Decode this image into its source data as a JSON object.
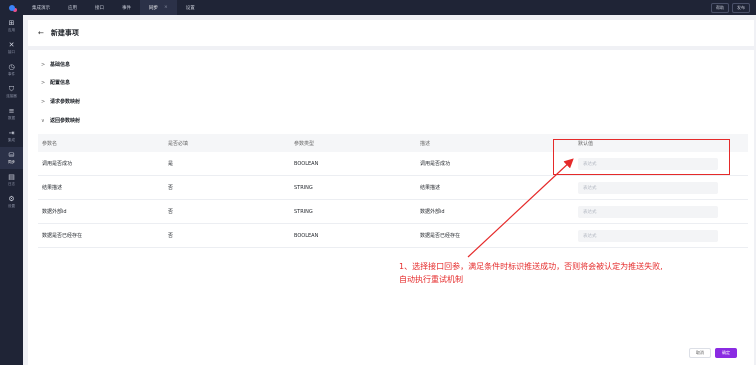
{
  "topbar": {
    "nav": [
      {
        "label": "集成演示",
        "active": false
      },
      {
        "label": "应用",
        "active": false
      },
      {
        "label": "接口",
        "active": false
      },
      {
        "label": "事件",
        "active": false
      },
      {
        "label": "同步",
        "active": true,
        "close": "×"
      },
      {
        "label": "设置",
        "active": false
      }
    ],
    "right_buttons": [
      "帮助",
      "发布"
    ]
  },
  "sidebar": {
    "items": [
      {
        "icon": "⊞",
        "label": "应用",
        "active": false
      },
      {
        "icon": "✕",
        "label": "接口",
        "active": false
      },
      {
        "icon": "◷",
        "label": "事件",
        "active": false
      },
      {
        "icon": "⛉",
        "label": "连接器",
        "active": false
      },
      {
        "icon": "≡",
        "label": "数据",
        "active": false
      },
      {
        "icon": "⇥",
        "label": "集成",
        "active": false
      },
      {
        "icon": "⛁",
        "label": "同步",
        "active": true
      },
      {
        "icon": "▤",
        "label": "日志",
        "active": false
      },
      {
        "icon": "⚙",
        "label": "设置",
        "active": false
      }
    ]
  },
  "header": {
    "back": "←",
    "title": "新建事项"
  },
  "sections": [
    {
      "chevron": ">",
      "label": "基础信息"
    },
    {
      "chevron": ">",
      "label": "配置信息"
    },
    {
      "chevron": ">",
      "label": "请求参数映射"
    },
    {
      "chevron": "∨",
      "label": "返回参数映射"
    }
  ],
  "table": {
    "headers": [
      "参数名",
      "是否必填",
      "参数类型",
      "描述",
      "默认值"
    ],
    "rows": [
      {
        "name": "调用是否成功",
        "required": "是",
        "type": "BOOLEAN",
        "desc": "调用是否成功",
        "placeholder": "表达式"
      },
      {
        "name": "结果描述",
        "required": "否",
        "type": "STRING",
        "desc": "结果描述",
        "placeholder": "表达式"
      },
      {
        "name": "数据外部id",
        "required": "否",
        "type": "STRING",
        "desc": "数据外部id",
        "placeholder": "表达式"
      },
      {
        "name": "数据是否已经存在",
        "required": "否",
        "type": "BOOLEAN",
        "desc": "数据是否已经存在",
        "placeholder": "表达式"
      }
    ]
  },
  "annotation": {
    "line1": "1、选择接口回参，满足条件时标识推送成功，否则将会被认定为推送失败,",
    "line2": "自动执行重试机制",
    "color": "#e52a2a"
  },
  "footer": {
    "cancel": "取消",
    "ok": "确定"
  },
  "colors": {
    "accent": "#8a2be2",
    "sidebar_bg": "#1f2436",
    "annotation": "#e52a2a"
  }
}
